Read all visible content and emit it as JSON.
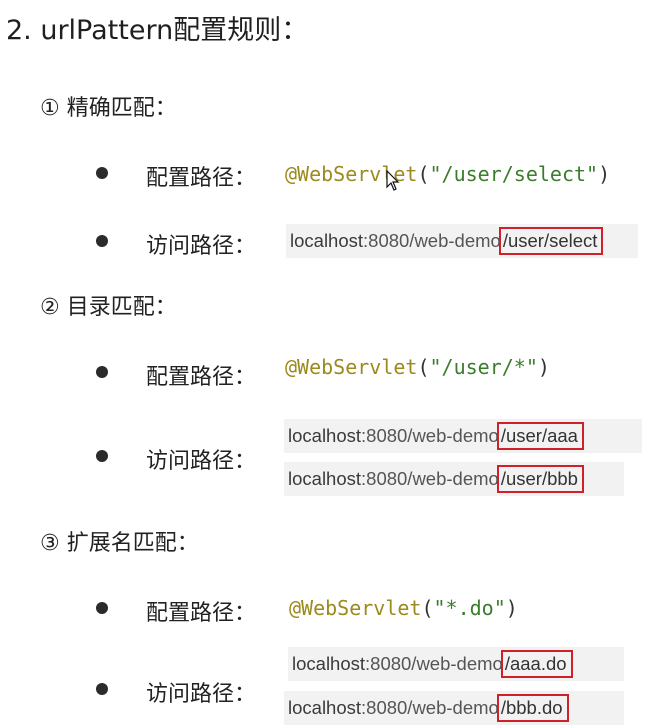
{
  "title": "2. urlPattern配置规则：",
  "sections": [
    {
      "heading": "①  精确匹配：",
      "config_label": "配置路径：",
      "access_label": "访问路径：",
      "annotation": "@WebServlet",
      "open": "(",
      "pattern": "\"/user/select\"",
      "close": ")",
      "urls": [
        {
          "host": "localhost",
          "rest": ":8080/web-demo",
          "path": "/user/select"
        }
      ]
    },
    {
      "heading": "②  目录匹配：",
      "config_label": "配置路径：",
      "access_label": "访问路径：",
      "annotation": "@WebServlet",
      "open": "(",
      "pattern": "\"/user/*\"",
      "close": ")",
      "urls": [
        {
          "host": "localhost",
          "rest": ":8080/web-demo",
          "path": "/user/aaa"
        },
        {
          "host": "localhost",
          "rest": ":8080/web-demo",
          "path": "/user/bbb"
        }
      ]
    },
    {
      "heading": "③  扩展名匹配：",
      "config_label": "配置路径：",
      "access_label": "访问路径：",
      "annotation": "@WebServlet",
      "open": "(",
      "pattern": "\"*.do\"",
      "close": ")",
      "urls": [
        {
          "host": "localhost",
          "rest": ":8080/web-demo",
          "path": "/aaa.do"
        },
        {
          "host": "localhost",
          "rest": ":8080/web-demo",
          "path": "/bbb.do"
        }
      ]
    }
  ],
  "colors": {
    "highlight_box": "#d0202a",
    "annotation": "#9c8a1e",
    "string": "#3a7d2c"
  }
}
